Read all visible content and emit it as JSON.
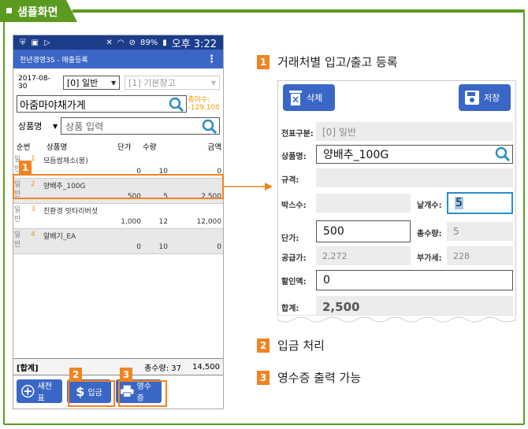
{
  "section_title": "샘플화면",
  "phone": {
    "status_clock": "오후 3:22",
    "status_battery": "89%",
    "appbar_title": "천년경영3S - 매출등록",
    "date": "2017-08-30",
    "type_select": "[0] 일반",
    "warehouse_select": "[1] 기본창고",
    "customer": "아줌마야채가게",
    "receivable_label": "총미수:",
    "receivable_value": "-129,100",
    "product_filter": "상품명",
    "product_placeholder": "상품 입력",
    "columns": [
      "순번",
      "상품명",
      "단가",
      "수량",
      "금액"
    ],
    "items": [
      {
        "side": "일반",
        "num": "1",
        "name": "모듬쌈채소(봉)",
        "price": "0",
        "qty": "10",
        "amount": "0"
      },
      {
        "side": "일반",
        "num": "2",
        "name": "양배추_100G",
        "price": "500",
        "qty": "5",
        "amount": "2,500"
      },
      {
        "side": "일반",
        "num": "3",
        "name": "친환경 밋타리버섯",
        "price": "1,000",
        "qty": "12",
        "amount": "12,000"
      },
      {
        "side": "일반",
        "num": "4",
        "name": "알배기_EA",
        "price": "0",
        "qty": "10",
        "amount": "0"
      }
    ],
    "total_label": "[합계]",
    "total_qty": "총수량: 37",
    "total_amount": "14,500",
    "buttons": {
      "new": "새전표",
      "deposit": "입금",
      "receipt": "영수증"
    }
  },
  "badges": [
    "1",
    "2",
    "3"
  ],
  "sections": [
    {
      "num": "1",
      "label": "거래처별 입고/출고 등록"
    },
    {
      "num": "2",
      "label": "입금 처리"
    },
    {
      "num": "3",
      "label": "영수증 출력 가능"
    }
  ],
  "detail": {
    "delete_label": "삭제",
    "save_label": "저장",
    "slip_type_label": "전표구분:",
    "slip_type_value": "[0] 일반",
    "product_label": "상품명:",
    "product_value": "양배추_100G",
    "spec_label": "규격:",
    "spec_value": "",
    "box_qty_label": "박스수:",
    "box_qty_value": "",
    "unit_qty_label": "낱개수:",
    "unit_qty_value": "5",
    "unit_price_label": "단가:",
    "unit_price_value": "500",
    "total_qty_label": "총수량:",
    "total_qty_value": "5",
    "supply_label": "공급가:",
    "supply_value": "2,272",
    "vat_label": "부가세:",
    "vat_value": "228",
    "discount_label": "할인액:",
    "discount_value": "0",
    "sum_label": "합계:",
    "sum_value": "2,500"
  },
  "colors": {
    "frame": "#5a9a1e",
    "accent": "#f08323",
    "primary": "#3a67c5",
    "statusbar": "#1c3d8a",
    "receivable": "#f29b00"
  }
}
